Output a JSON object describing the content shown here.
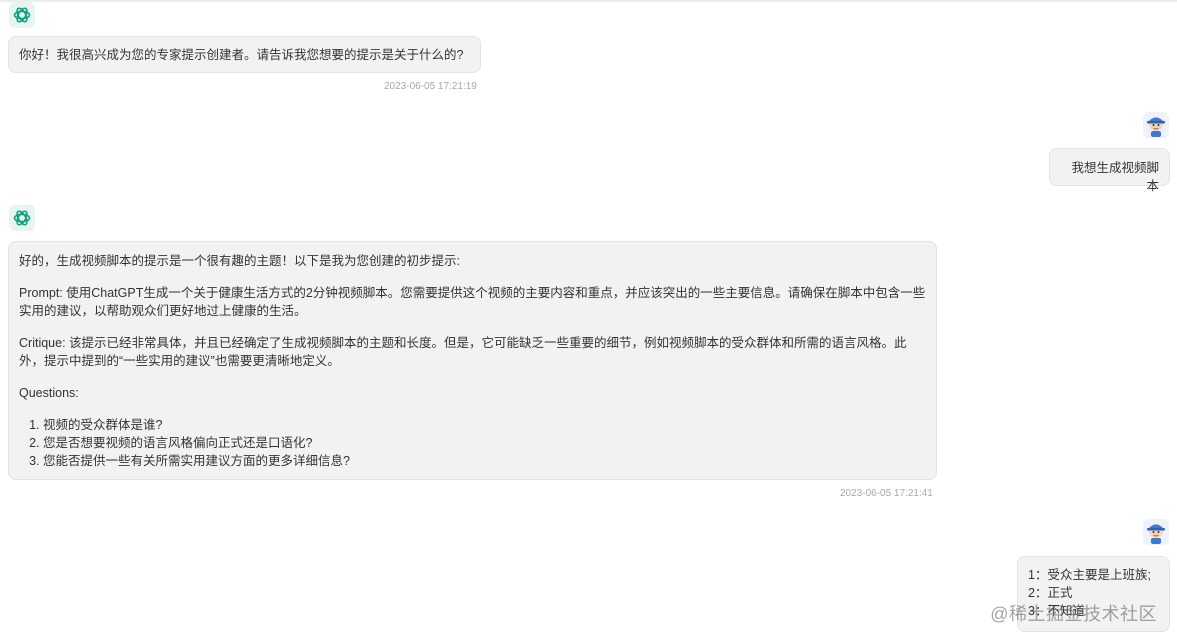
{
  "messages": {
    "bot_greeting": {
      "text": "你好！我很高兴成为您的专家提示创建者。请告诉我您想要的提示是关于什么的?",
      "time": "2023-06-05 17:21:19"
    },
    "user_request": {
      "text": "我想生成视频脚本"
    },
    "bot_reply": {
      "intro": "好的，生成视频脚本的提示是一个很有趣的主题！以下是我为您创建的初步提示:",
      "prompt": "Prompt: 使用ChatGPT生成一个关于健康生活方式的2分钟视频脚本。您需要提供这个视频的主要内容和重点，并应该突出的一些主要信息。请确保在脚本中包含一些实用的建议，以帮助观众们更好地过上健康的生活。",
      "critique": "Critique: 该提示已经非常具体，并且已经确定了生成视频脚本的主题和长度。但是，它可能缺乏一些重要的细节，例如视频脚本的受众群体和所需的语言风格。此外，提示中提到的“一些实用的建议”也需要更清晰地定义。",
      "questions_label": "Questions:",
      "questions": [
        "视频的受众群体是谁?",
        "您是否想要视频的语言风格偏向正式还是口语化?",
        "您能否提供一些有关所需实用建议方面的更多详细信息?"
      ],
      "time": "2023-06-05 17:21:41"
    },
    "user_answers": {
      "lines": [
        "1：受众主要是上班族;",
        "2：正式",
        "3：不知道"
      ]
    }
  },
  "icons": {
    "bot_avatar": "openai-logo-icon",
    "user_avatar": "cartoon-user-avatar-icon"
  },
  "watermark": "@稀土掘金技术社区",
  "colors": {
    "bubble_bg": "#f2f2f2",
    "bubble_border": "#e3e3e3",
    "bot_logo": "#10a37f",
    "timestamp": "#a8a8a8"
  }
}
